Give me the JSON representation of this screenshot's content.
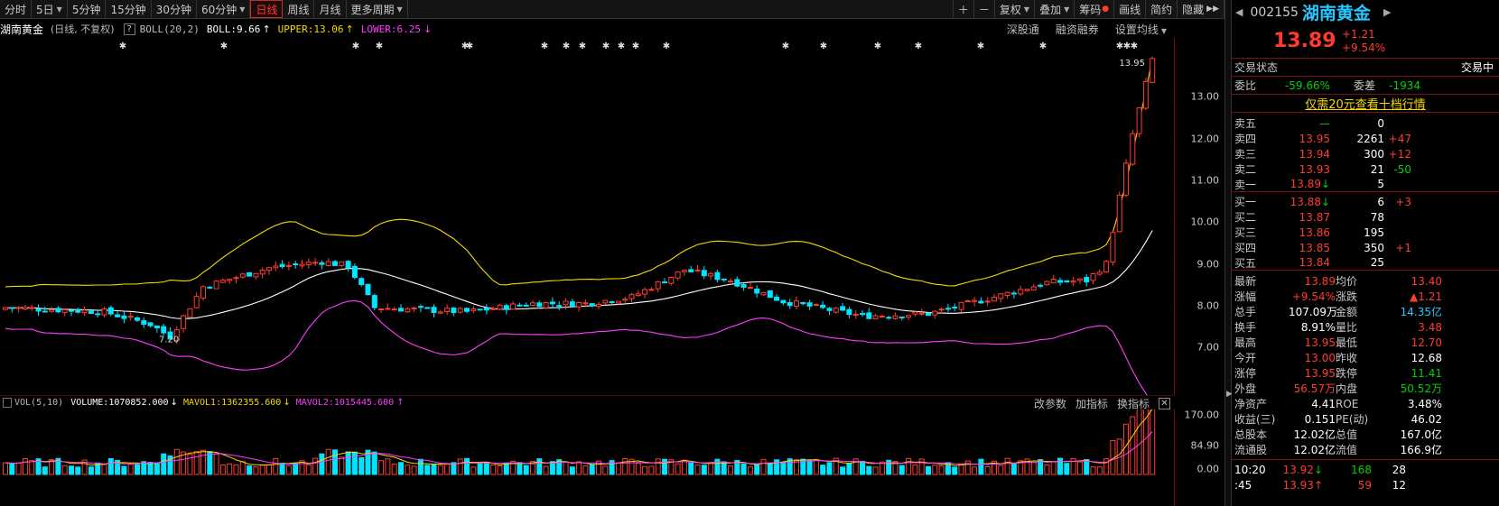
{
  "toolbar": {
    "periods": [
      "分时",
      "5日",
      "5分钟",
      "15分钟",
      "30分钟",
      "60分钟",
      "日线",
      "周线",
      "月线",
      "更多周期"
    ],
    "active_period": "日线",
    "right_items": [
      "复权",
      "叠加",
      "筹码",
      "画线",
      "简约",
      "隐藏"
    ]
  },
  "chart_head": {
    "stock_name": "湖南黄金",
    "mode": "(日线, 不复权)",
    "help": "?",
    "boll_label": "BOLL(20,2)",
    "boll": "BOLL:9.66",
    "upper": "UPPER:13.06",
    "lower": "LOWER:6.25",
    "right_links": [
      "深股通",
      "融资融券",
      "设置均线"
    ]
  },
  "price_axis": [
    "13.00",
    "12.00",
    "11.00",
    "10.00",
    "9.00",
    "8.00",
    "7.00"
  ],
  "volume_axis": [
    "170.00",
    "84.90",
    "0.00"
  ],
  "annotations": {
    "high_label": "13.95",
    "low_label": "7.20"
  },
  "vol_head": {
    "label": "VOL(5,10)",
    "volume": "VOLUME:1070852.000",
    "mavol1": "MAVOL1:1362355.600",
    "mavol2": "MAVOL2:1015445.600",
    "right_links": [
      "改参数",
      "加指标",
      "换指标"
    ]
  },
  "panel": {
    "code": "002155",
    "name": "湖南黄金",
    "price": "13.89",
    "change": "+1.21",
    "change_pct": "+9.54%",
    "status_label": "交易状态",
    "status_value": "交易中",
    "weibi_label": "委比",
    "weibi": "-59.66%",
    "weicha_label": "委差",
    "weicha": "-1934",
    "promo": "仅需20元查看十档行情",
    "asks": [
      {
        "label": "卖五",
        "price": "—",
        "vol": "0",
        "chg": ""
      },
      {
        "label": "卖四",
        "price": "13.95",
        "vol": "2261",
        "chg": "+47"
      },
      {
        "label": "卖三",
        "price": "13.94",
        "vol": "300",
        "chg": "+12"
      },
      {
        "label": "卖二",
        "price": "13.93",
        "vol": "21",
        "chg": "-50"
      },
      {
        "label": "卖一",
        "price": "13.89",
        "vol": "5",
        "chg": ""
      }
    ],
    "bids": [
      {
        "label": "买一",
        "price": "13.88",
        "vol": "6",
        "chg": "+3"
      },
      {
        "label": "买二",
        "price": "13.87",
        "vol": "78",
        "chg": ""
      },
      {
        "label": "买三",
        "price": "13.86",
        "vol": "195",
        "chg": ""
      },
      {
        "label": "买四",
        "price": "13.85",
        "vol": "350",
        "chg": "+1"
      },
      {
        "label": "买五",
        "price": "13.84",
        "vol": "25",
        "chg": ""
      }
    ],
    "stats": [
      [
        {
          "l": "最新",
          "v": "13.89",
          "c": "red"
        },
        {
          "l": "均价",
          "v": "13.40",
          "c": "red"
        }
      ],
      [
        {
          "l": "涨幅",
          "v": "+9.54%",
          "c": "red"
        },
        {
          "l": "涨跌",
          "v": "▲1.21",
          "c": "red"
        }
      ],
      [
        {
          "l": "总手",
          "v": "107.09万",
          "c": "white"
        },
        {
          "l": "金额",
          "v": "14.35亿",
          "c": "cyan"
        }
      ],
      [
        {
          "l": "换手",
          "v": "8.91%",
          "c": "white"
        },
        {
          "l": "量比",
          "v": "3.48",
          "c": "red"
        }
      ],
      [
        {
          "l": "最高",
          "v": "13.95",
          "c": "red"
        },
        {
          "l": "最低",
          "v": "12.70",
          "c": "red"
        }
      ],
      [
        {
          "l": "今开",
          "v": "13.00",
          "c": "red"
        },
        {
          "l": "昨收",
          "v": "12.68",
          "c": "white"
        }
      ],
      [
        {
          "l": "涨停",
          "v": "13.95",
          "c": "red"
        },
        {
          "l": "跌停",
          "v": "11.41",
          "c": "green"
        }
      ],
      [
        {
          "l": "外盘",
          "v": "56.57万",
          "c": "red"
        },
        {
          "l": "内盘",
          "v": "50.52万",
          "c": "green"
        }
      ],
      [
        {
          "l": "净资产",
          "v": "4.41",
          "c": "white"
        },
        {
          "l": "ROE",
          "v": "3.48%",
          "c": "white"
        }
      ],
      [
        {
          "l": "收益(三)",
          "v": "0.151",
          "c": "white"
        },
        {
          "l": "PE(动)",
          "v": "46.02",
          "c": "white"
        }
      ],
      [
        {
          "l": "总股本",
          "v": "12.02亿",
          "c": "white"
        },
        {
          "l": "总值",
          "v": "167.0亿",
          "c": "white"
        }
      ],
      [
        {
          "l": "流通股",
          "v": "12.02亿",
          "c": "white"
        },
        {
          "l": "流值",
          "v": "166.9亿",
          "c": "white"
        }
      ]
    ],
    "ticks": [
      {
        "time": "10:20",
        "price": "13.92",
        "dir": "down",
        "vol": "168",
        "n": "28",
        "pc": "red",
        "vc": "green"
      },
      {
        "time": ":45",
        "price": "13.93",
        "dir": "up",
        "vol": "59",
        "n": "12",
        "pc": "red",
        "vc": "red"
      }
    ]
  },
  "colors": {
    "up": "#ff3b2f",
    "down": "#00e5ff",
    "upper": "#f5d800",
    "mid": "#ffffff",
    "lower": "#ff3cff"
  }
}
